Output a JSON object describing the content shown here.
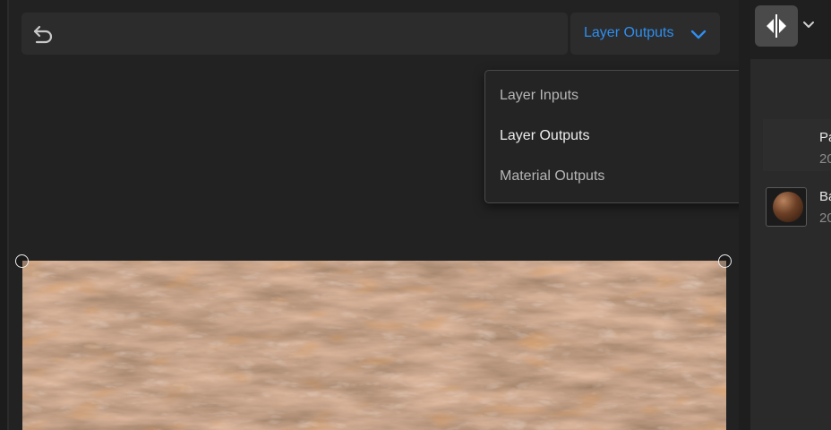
{
  "toolbar": {
    "undo_icon": "undo-icon",
    "output_select": {
      "selected_label": "Layer Outputs",
      "chevron_icon": "chevron-down-icon",
      "accent_color": "#2f8ef0"
    }
  },
  "dropdown_menu": {
    "items": [
      {
        "label": "Layer Inputs",
        "selected": false
      },
      {
        "label": "Layer Outputs",
        "selected": true,
        "check_icon": "checkmark-icon"
      },
      {
        "label": "Material Outputs",
        "selected": false
      }
    ]
  },
  "viewport": {
    "content": "bark-texture-preview",
    "colors": {
      "base": "#7a4f33",
      "rust": "#b0531c",
      "highlight": "#c9ab95"
    }
  },
  "right_panel": {
    "compare_icon": "compare-split-icon",
    "chevron_icon": "chevron-down-icon",
    "list": [
      {
        "title": "Pa",
        "subtitle": "20"
      },
      {
        "title": "Ba",
        "subtitle": "20"
      }
    ]
  }
}
